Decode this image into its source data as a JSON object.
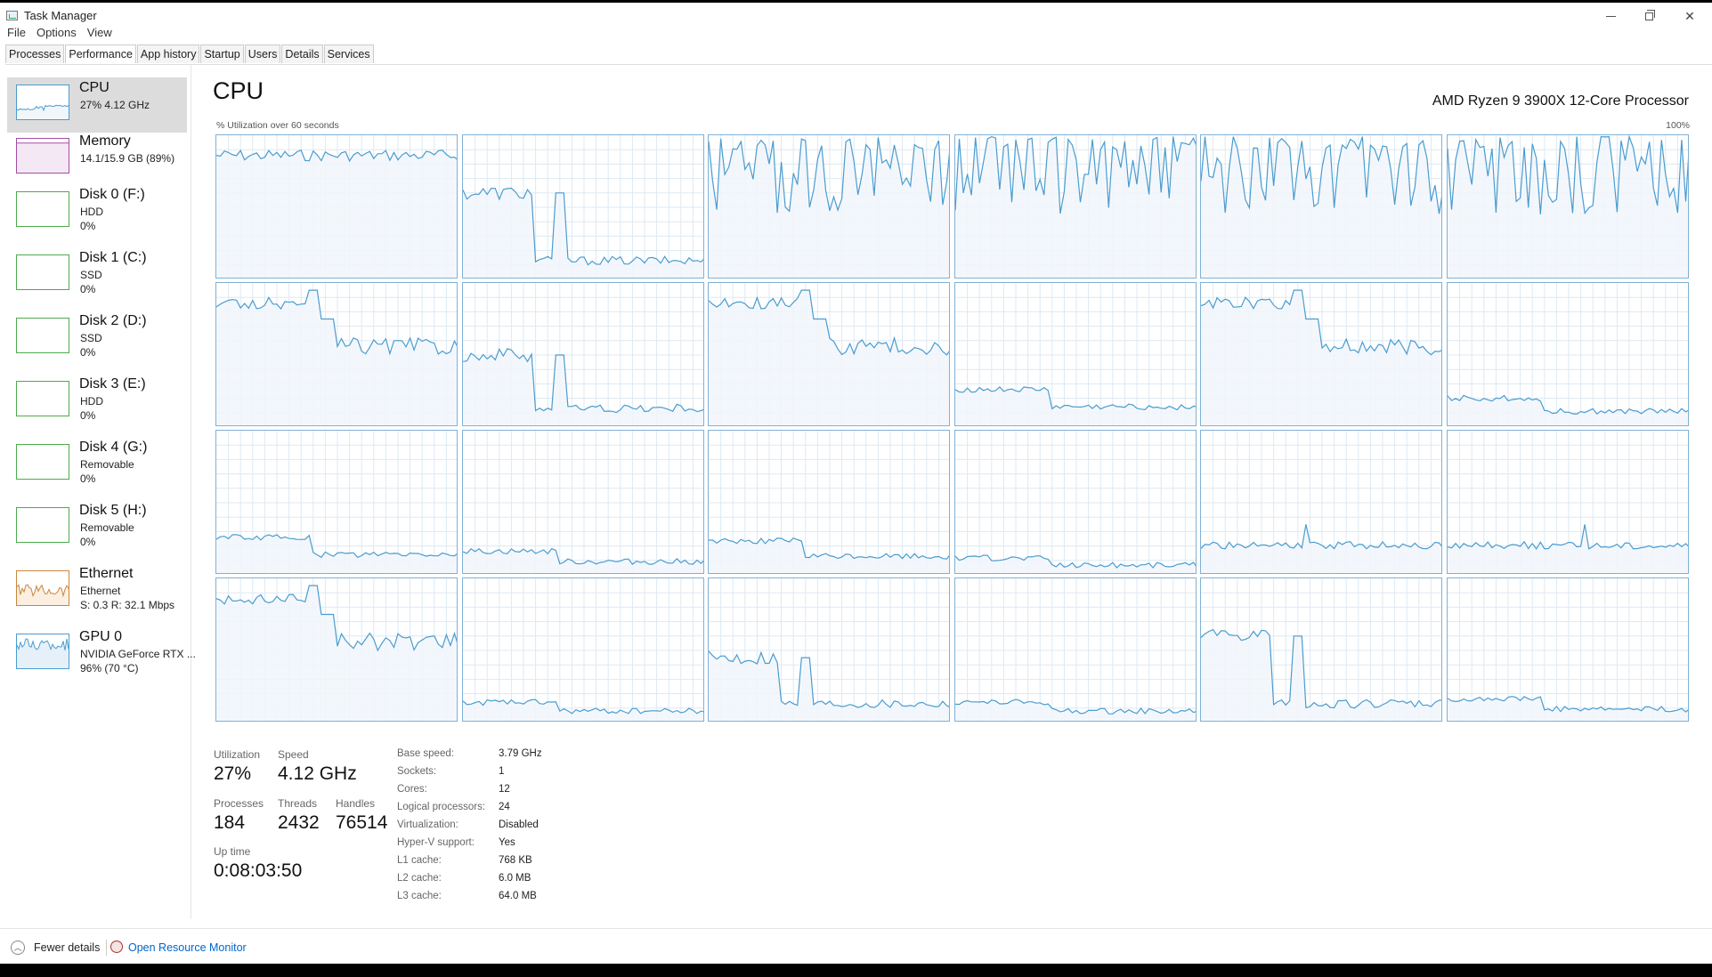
{
  "window": {
    "title": "Task Manager",
    "controls": {
      "minimize": "minimize-icon",
      "restore": "restore-icon",
      "close": "✕"
    }
  },
  "menu": [
    "File",
    "Options",
    "View"
  ],
  "tabs": [
    "Processes",
    "Performance",
    "App history",
    "Startup",
    "Users",
    "Details",
    "Services"
  ],
  "active_tab": "Performance",
  "sidebar": [
    {
      "name": "CPU",
      "sub": "27%  4.12 GHz",
      "sub2": "",
      "kind": "cpu",
      "selected": true
    },
    {
      "name": "Memory",
      "sub": "14.1/15.9 GB (89%)",
      "sub2": "",
      "kind": "memory"
    },
    {
      "name": "Disk 0 (F:)",
      "sub": "HDD",
      "sub2": "0%",
      "kind": "disk"
    },
    {
      "name": "Disk 1 (C:)",
      "sub": "SSD",
      "sub2": "0%",
      "kind": "disk"
    },
    {
      "name": "Disk 2 (D:)",
      "sub": "SSD",
      "sub2": "0%",
      "kind": "disk"
    },
    {
      "name": "Disk 3 (E:)",
      "sub": "HDD",
      "sub2": "0%",
      "kind": "disk"
    },
    {
      "name": "Disk 4 (G:)",
      "sub": "Removable",
      "sub2": "0%",
      "kind": "disk"
    },
    {
      "name": "Disk 5 (H:)",
      "sub": "Removable",
      "sub2": "0%",
      "kind": "disk"
    },
    {
      "name": "Ethernet",
      "sub": "Ethernet",
      "sub2": "S: 0.3  R: 32.1 Mbps",
      "kind": "ethernet"
    },
    {
      "name": "GPU 0",
      "sub": "NVIDIA GeForce RTX ...",
      "sub2": "96% (70 °C)",
      "kind": "gpu"
    }
  ],
  "main": {
    "title": "CPU",
    "model": "AMD Ryzen 9 3900X 12-Core Processor",
    "caption": "% Utilization over 60 seconds",
    "max_label": "100%",
    "graph_colors": {
      "line": "#4a9ccf",
      "fill": "#f1f6fb",
      "grid": "#dde9f3",
      "border": "#7fb1d6"
    }
  },
  "stats": {
    "utilization_label": "Utilization",
    "utilization": "27%",
    "speed_label": "Speed",
    "speed": "4.12 GHz",
    "processes_label": "Processes",
    "processes": "184",
    "threads_label": "Threads",
    "threads": "2432",
    "handles_label": "Handles",
    "handles": "76514",
    "uptime_label": "Up time",
    "uptime": "0:08:03:50"
  },
  "specs": [
    {
      "label": "Base speed:",
      "value": "3.79 GHz"
    },
    {
      "label": "Sockets:",
      "value": "1"
    },
    {
      "label": "Cores:",
      "value": "12"
    },
    {
      "label": "Logical processors:",
      "value": "24"
    },
    {
      "label": "Virtualization:",
      "value": "Disabled"
    },
    {
      "label": "Hyper-V support:",
      "value": "Yes"
    },
    {
      "label": "L1 cache:",
      "value": "768 KB"
    },
    {
      "label": "L2 cache:",
      "value": "6.0 MB"
    },
    {
      "label": "L3 cache:",
      "value": "64.0 MB"
    }
  ],
  "footer": {
    "fewer_details": "Fewer details",
    "resource_monitor": "Open Resource Monitor"
  },
  "cores": [
    {
      "pattern": "high",
      "level": 0.85
    },
    {
      "pattern": "drop",
      "level": 0.55
    },
    {
      "pattern": "spiky",
      "level": 0.7
    },
    {
      "pattern": "spiky",
      "level": 0.7
    },
    {
      "pattern": "spiky",
      "level": 0.7
    },
    {
      "pattern": "spiky",
      "level": 0.75
    },
    {
      "pattern": "highdrop",
      "level": 0.85
    },
    {
      "pattern": "drop",
      "level": 0.45
    },
    {
      "pattern": "highdrop",
      "level": 0.8
    },
    {
      "pattern": "low",
      "level": 0.2
    },
    {
      "pattern": "highdrop",
      "level": 0.8
    },
    {
      "pattern": "low",
      "level": 0.15
    },
    {
      "pattern": "low",
      "level": 0.2
    },
    {
      "pattern": "low",
      "level": 0.12
    },
    {
      "pattern": "low",
      "level": 0.18
    },
    {
      "pattern": "low",
      "level": 0.08
    },
    {
      "pattern": "lowspike",
      "level": 0.2
    },
    {
      "pattern": "lowspike",
      "level": 0.2
    },
    {
      "pattern": "highdrop",
      "level": 0.7
    },
    {
      "pattern": "low",
      "level": 0.1
    },
    {
      "pattern": "drop",
      "level": 0.4
    },
    {
      "pattern": "low",
      "level": 0.1
    },
    {
      "pattern": "drop",
      "level": 0.55
    },
    {
      "pattern": "low",
      "level": 0.12
    }
  ]
}
